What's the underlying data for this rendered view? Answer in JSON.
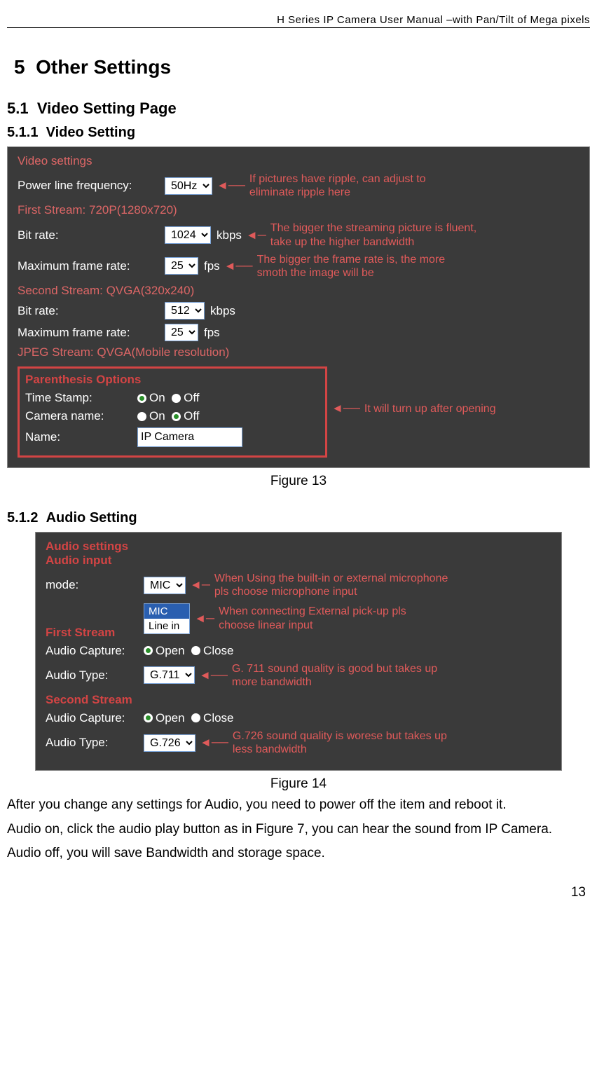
{
  "header": "H Series IP Camera User Manual –with Pan/Tilt of Mega pixels",
  "section": {
    "num": "5",
    "title": "Other Settings"
  },
  "sub1": {
    "num": "5.1",
    "title": "Video Setting Page"
  },
  "sub11": {
    "num": "5.1.1",
    "title": "Video Setting"
  },
  "sub12": {
    "num": "5.1.2",
    "title": "Audio Setting"
  },
  "video": {
    "heading": "Video settings",
    "powerline": {
      "label": "Power line frequency:",
      "value": "50Hz",
      "note": "If pictures have ripple, can adjust to eliminate ripple here"
    },
    "stream1": {
      "label": "First Stream: 720P(1280x720)"
    },
    "bitrate1": {
      "label": "Bit rate:",
      "value": "1024",
      "unit": "kbps",
      "note": "The bigger the streaming picture is fluent, take up the higher bandwidth"
    },
    "fps1": {
      "label": "Maximum frame rate:",
      "value": "25",
      "unit": "fps",
      "note": "The bigger the frame rate is, the more smoth the image will be"
    },
    "stream2": {
      "label": "Second Stream: QVGA(320x240)"
    },
    "bitrate2": {
      "label": "Bit rate:",
      "value": "512",
      "unit": "kbps"
    },
    "fps2": {
      "label": "Maximum frame rate:",
      "value": "25",
      "unit": "fps"
    },
    "jpeg": {
      "label": "JPEG Stream: QVGA(Mobile resolution)"
    },
    "paren": {
      "heading": "Parenthesis Options",
      "ts": "Time Stamp:",
      "cam": "Camera name:",
      "name": "Name:",
      "on": "On",
      "off": "Off",
      "nameval": "IP Camera",
      "note": "It will turn up after opening"
    }
  },
  "fig13": "Figure 13",
  "audio": {
    "heading": "Audio settings",
    "input": "Audio input",
    "mode": {
      "label": "mode:",
      "value": "MIC",
      "opt1": "MIC",
      "opt2": "Line in",
      "note1": "When Using the built-in or external microphone pls choose microphone input",
      "note2": "When connecting External pick-up pls choose linear input"
    },
    "first": "First Stream",
    "cap": {
      "label": "Audio Capture:",
      "open": "Open",
      "close": "Close"
    },
    "type1": {
      "label": "Audio Type:",
      "value": "G.711",
      "note": "G. 711 sound quality is good but takes up more bandwidth"
    },
    "second": "Second Stream",
    "type2": {
      "label": "Audio Type:",
      "value": "G.726",
      "note": "G.726 sound quality is worese but takes up less bandwidth"
    }
  },
  "fig14": "Figure 14",
  "para1": "After you change any settings for Audio, you need to power off the item and reboot it.",
  "para2": "Audio on, click the audio play button as in Figure 7, you can hear the sound from IP Camera.",
  "para3": "Audio off, you will save Bandwidth and storage space.",
  "pagenum": "13"
}
